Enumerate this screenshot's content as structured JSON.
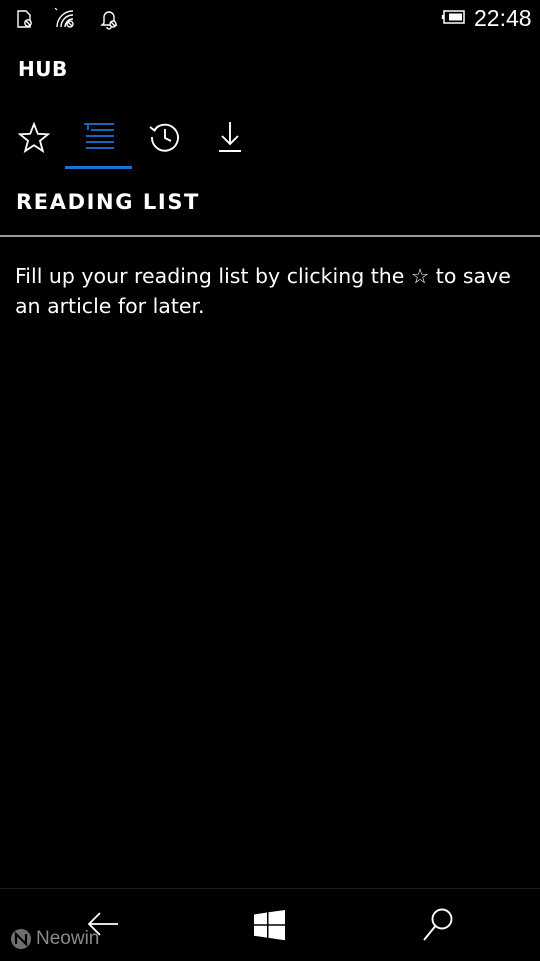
{
  "status_bar": {
    "time": "22:48",
    "icons": [
      "sim-off-icon",
      "wifi-icon",
      "quiet-hours-icon",
      "battery-icon"
    ]
  },
  "header": {
    "title": "HUB"
  },
  "tabs": [
    {
      "icon": "star-icon",
      "label": "Favorites",
      "selected": false
    },
    {
      "icon": "reading-list-icon",
      "label": "Reading list",
      "selected": true
    },
    {
      "icon": "history-icon",
      "label": "History",
      "selected": false
    },
    {
      "icon": "download-icon",
      "label": "Downloads",
      "selected": false
    }
  ],
  "main": {
    "section_title": "READING LIST",
    "empty_message": "Fill up your reading list by clicking the ☆ to save an article for later."
  },
  "nav_bar": {
    "buttons": [
      "back-arrow-icon",
      "windows-logo-icon",
      "search-icon"
    ]
  },
  "watermark": {
    "text": "Neowin"
  },
  "colors": {
    "background": "#000000",
    "text": "#ffffff",
    "accent": "#1b74d1",
    "divider": "#9a9a9a"
  }
}
